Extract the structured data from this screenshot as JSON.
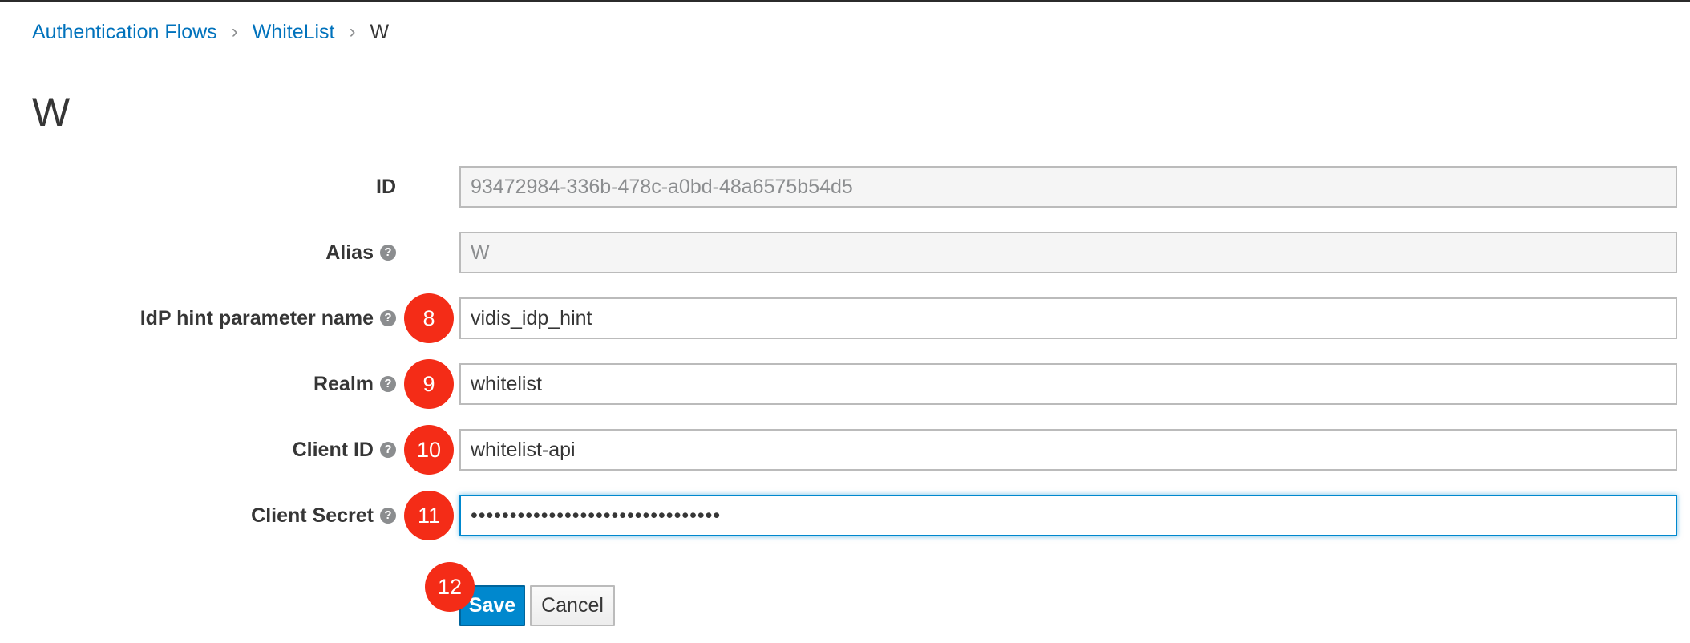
{
  "breadcrumb": {
    "items": [
      "Authentication Flows",
      "WhiteList"
    ],
    "current": "W",
    "separator": "›"
  },
  "page_title": "W",
  "form": {
    "fields": [
      {
        "label": "ID",
        "value": "93472984-336b-478c-a0bd-48a6575b54d5",
        "readonly": true,
        "help": false
      },
      {
        "label": "Alias",
        "value": "W",
        "readonly": true,
        "help": true
      },
      {
        "label": "IdP hint parameter name",
        "value": "vidis_idp_hint",
        "readonly": false,
        "help": true,
        "badge": "8"
      },
      {
        "label": "Realm",
        "value": "whitelist",
        "readonly": false,
        "help": true,
        "badge": "9"
      },
      {
        "label": "Client ID",
        "value": "whitelist-api",
        "readonly": false,
        "help": true,
        "badge": "10"
      },
      {
        "label": "Client Secret",
        "value": "••••••••••••••••••••••••••••••••",
        "readonly": false,
        "help": true,
        "badge": "11",
        "focused": true
      }
    ],
    "help_glyph": "?"
  },
  "actions": {
    "save_label": "Save",
    "cancel_label": "Cancel",
    "save_badge": "12"
  },
  "colors": {
    "link": "#0072bc",
    "primary": "#0088ce",
    "badge": "#f42c17"
  },
  "icons": {
    "help": "question-circle-icon",
    "separator": "angle-right-icon"
  }
}
